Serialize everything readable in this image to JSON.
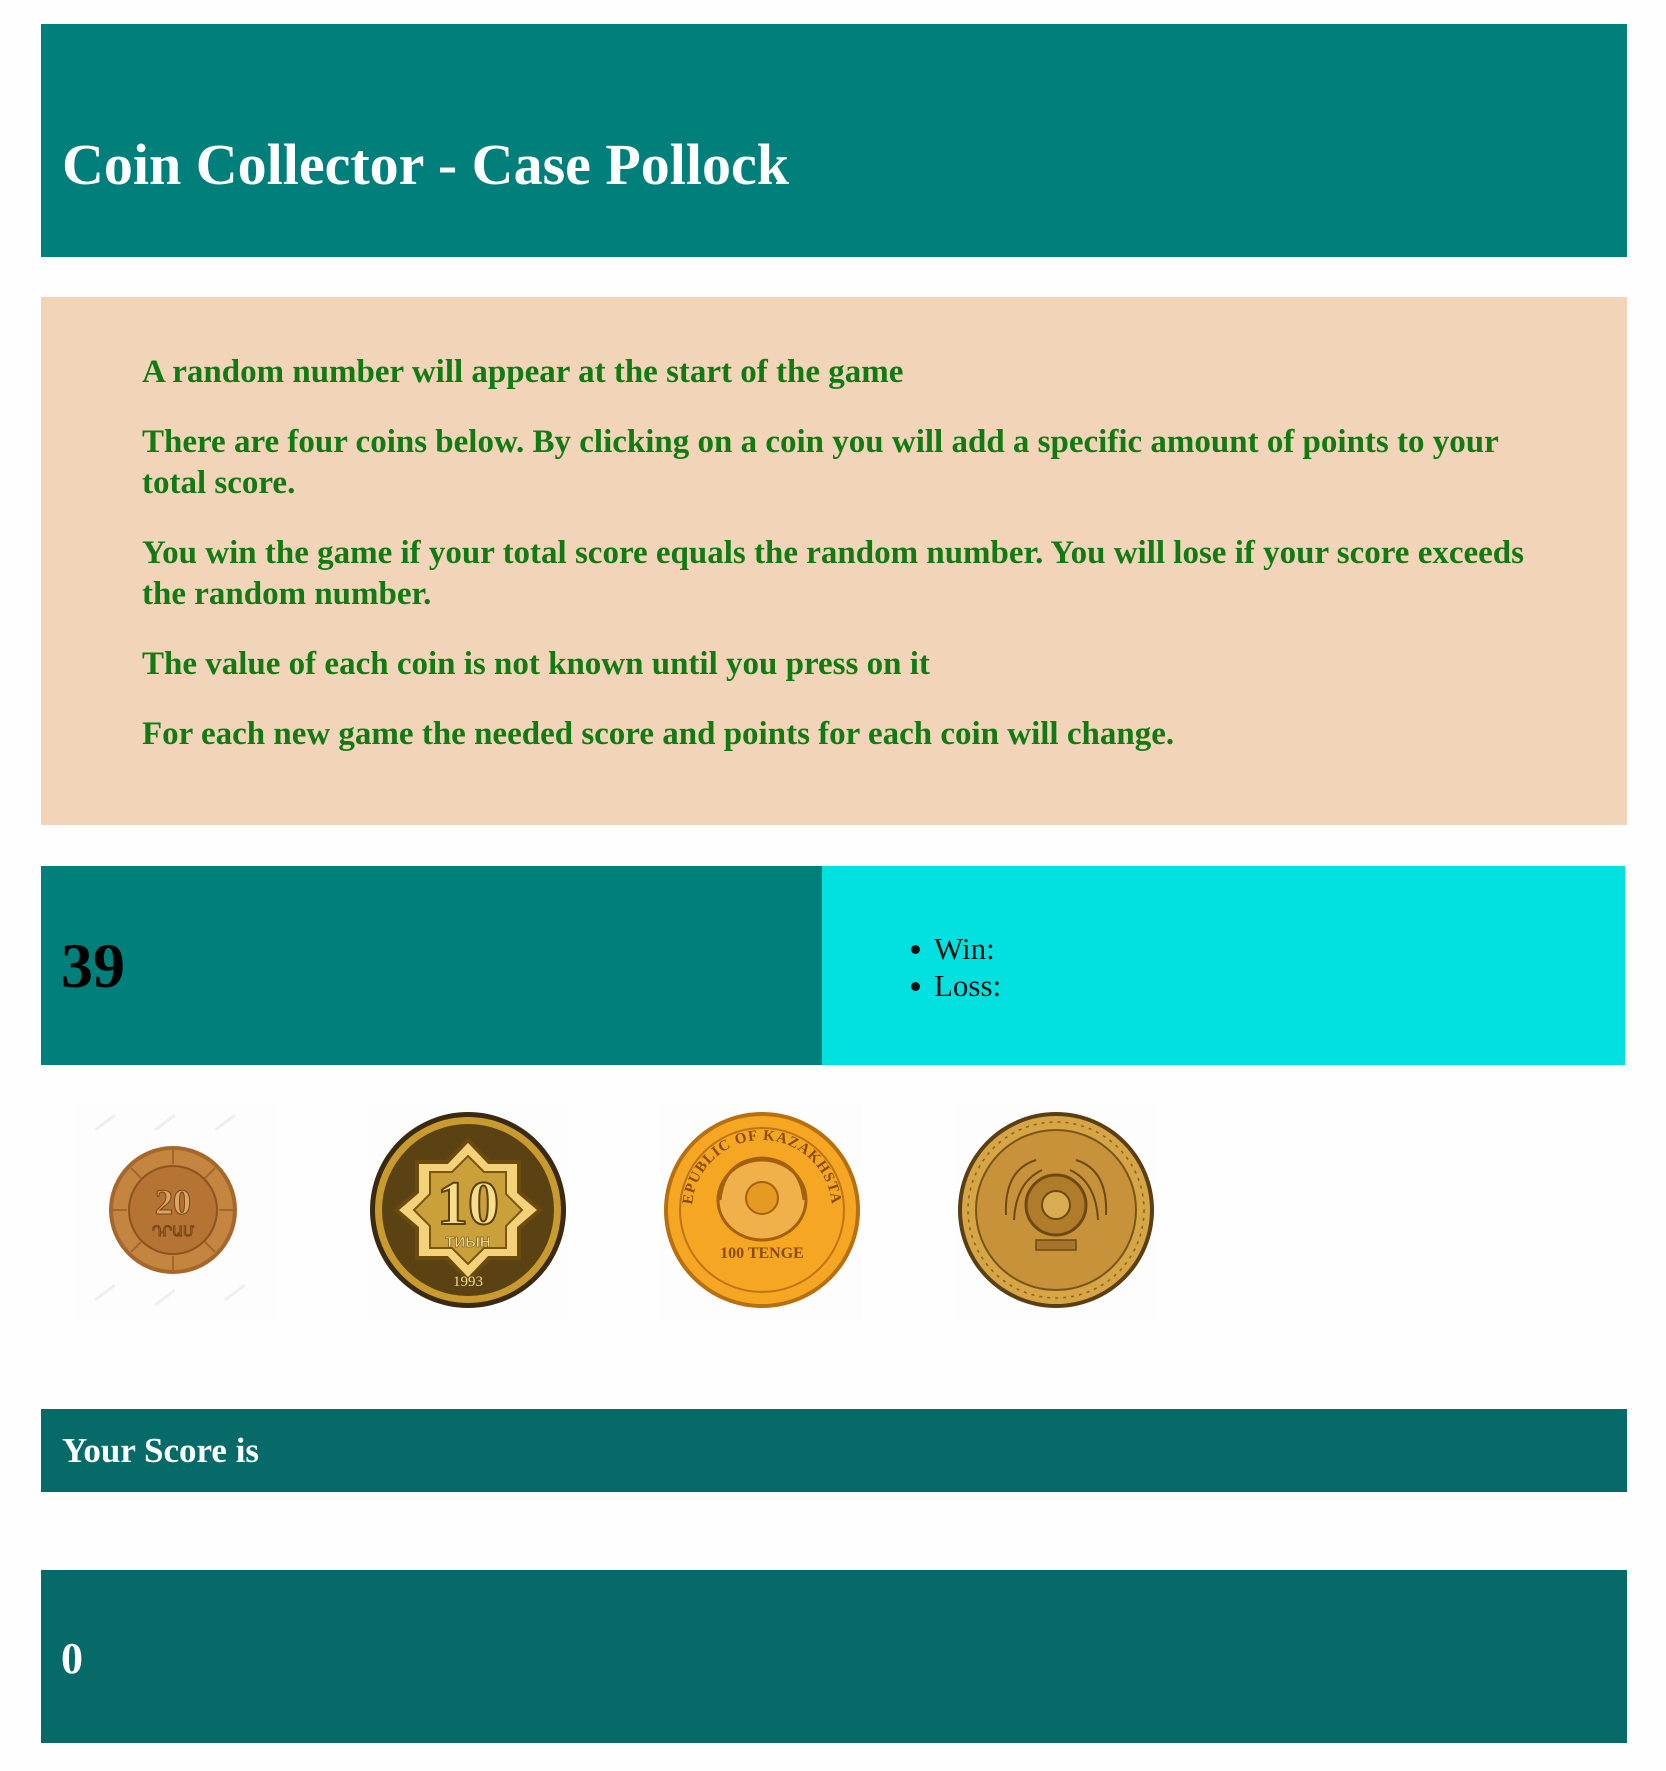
{
  "header": {
    "title": "Coin Collector - Case Pollock"
  },
  "instructions": [
    "A random number will appear at the start of the game",
    "There are four coins below. By clicking on a coin you will add a specific amount of points to your total score.",
    "You win the game if your total score equals the random number. You will lose if your score exceeds the random number.",
    "The value of each coin is not known until you press on it",
    "For each new game the needed score and points for each coin will change."
  ],
  "game": {
    "target_number": "39",
    "record": {
      "win_label": "Win:",
      "loss_label": "Loss:"
    }
  },
  "coins": [
    {
      "name": "coin-1",
      "face_text": "20",
      "sub_text": "ԴՐԱՄ",
      "color": "#b8772f"
    },
    {
      "name": "coin-2",
      "face_text": "10",
      "sub_text": "ТИЫН",
      "year": "1993",
      "color": "#c99a2e"
    },
    {
      "name": "coin-3",
      "face_text": "REPUBLIC OF KAZAKHSTAN",
      "sub_text": "100 TENGE",
      "color": "#f0a22a"
    },
    {
      "name": "coin-4",
      "face_text": "",
      "sub_text": "",
      "color": "#d5a546"
    }
  ],
  "score": {
    "label": "Your Score is",
    "value": "0"
  },
  "colors": {
    "header_bg": "#007f7b",
    "instructions_bg": "#f2d5b9",
    "instructions_text": "#117a12",
    "record_bg": "#02e1df",
    "score_bg": "#066a68"
  }
}
